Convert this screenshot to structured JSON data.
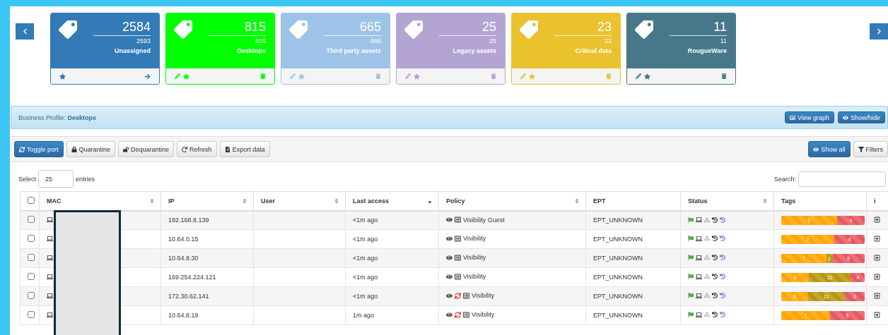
{
  "cards": [
    {
      "count": "2584",
      "total": "2593",
      "label": "Unassigned",
      "color": "#337ab7",
      "kind": "default"
    },
    {
      "count": "815",
      "total": "815",
      "label": "Desktops",
      "color": "#00ff00",
      "kind": "custom"
    },
    {
      "count": "665",
      "total": "666",
      "label": "Third party assets",
      "color": "#9dc3e8",
      "kind": "custom"
    },
    {
      "count": "25",
      "total": "25",
      "label": "Legacy assets",
      "color": "#b4a4d3",
      "kind": "custom"
    },
    {
      "count": "23",
      "total": "23",
      "label": "Critical data",
      "color": "#e9c22d",
      "kind": "custom"
    },
    {
      "count": "11",
      "total": "11",
      "label": "RougueWare",
      "color": "#46788a",
      "kind": "custom"
    }
  ],
  "profile": {
    "label": "Business Profile:",
    "value": "Desktops"
  },
  "panel_buttons": [
    {
      "label": "View graph"
    },
    {
      "label": "Show/hide"
    }
  ],
  "toolbar": {
    "left": [
      {
        "label": "Toggle port",
        "kind": "primary"
      },
      {
        "label": "Quarantine",
        "kind": "default"
      },
      {
        "label": "Dequarantine",
        "kind": "default"
      },
      {
        "label": "Refresh",
        "kind": "default"
      },
      {
        "label": "Export data",
        "kind": "default"
      }
    ],
    "right": [
      {
        "label": "Show all",
        "kind": "primary"
      },
      {
        "label": "Filters",
        "kind": "default"
      }
    ]
  },
  "length": {
    "before": "Select",
    "value": "25",
    "after": "entries"
  },
  "search": {
    "label": "Search:"
  },
  "table": {
    "select_all": {
      "checked": false
    },
    "columns": [
      {
        "label": "MAC",
        "sortable": true,
        "sorted": false
      },
      {
        "label": "IP",
        "sortable": true,
        "sorted": false
      },
      {
        "label": "User",
        "sortable": true,
        "sorted": false
      },
      {
        "label": "Last access",
        "sortable": true,
        "sorted": true
      },
      {
        "label": "Policy",
        "sortable": true,
        "sorted": false
      },
      {
        "label": "EPT",
        "sortable": false,
        "sorted": false
      },
      {
        "label": "Status",
        "sortable": true,
        "sorted": false
      },
      {
        "label": "Tags",
        "sortable": false,
        "sorted": false
      },
      {
        "label": "i",
        "sortable": false,
        "sorted": false
      }
    ],
    "rows": [
      {
        "checked": false,
        "ip": "192.168.8.139",
        "last_access": "<1m ago",
        "policy": {
          "syncing": false,
          "label": "Visibility Guest"
        },
        "ept": "EPT_UNKNOWN",
        "tags": [
          {
            "label": "8",
            "color": "#ffa500"
          },
          {
            "label": "4",
            "color": "#e8585f"
          }
        ]
      },
      {
        "checked": false,
        "ip": "10.64.0.15",
        "last_access": "<1m ago",
        "policy": {
          "syncing": false,
          "label": "Visibility"
        },
        "ept": "EPT_UNKNOWN",
        "tags": [
          {
            "label": "7",
            "color": "#ffa500"
          },
          {
            "label": "4",
            "color": "#e8585f"
          }
        ]
      },
      {
        "checked": false,
        "ip": "10.64.8.30",
        "last_access": "<1m ago",
        "policy": {
          "syncing": false,
          "label": "Visibility"
        },
        "ept": "EPT_UNKNOWN",
        "tags": [
          {
            "label": "7",
            "color": "#ffa500"
          },
          {
            "label": "1",
            "color": "#b8960c"
          },
          {
            "label": "5",
            "color": "#e8585f"
          }
        ]
      },
      {
        "checked": false,
        "ip": "169.254.224.121",
        "last_access": "<1m ago",
        "policy": {
          "syncing": false,
          "label": "Visibility"
        },
        "ept": "EPT_UNKNOWN",
        "tags": [
          {
            "label": "8",
            "color": "#ffa500"
          },
          {
            "label": "12",
            "color": "#b8960c"
          },
          {
            "label": "4",
            "color": "#e8585f"
          }
        ]
      },
      {
        "checked": false,
        "ip": "172.30.62.141",
        "last_access": "<1m ago",
        "policy": {
          "syncing": true,
          "label": "Visibility"
        },
        "ept": "EPT_UNKNOWN",
        "tags": [
          {
            "label": "8",
            "color": "#ffa500"
          },
          {
            "label": "11",
            "color": "#b8960c"
          },
          {
            "label": "6",
            "color": "#e8585f"
          }
        ]
      },
      {
        "checked": false,
        "ip": "10.64.8.19",
        "last_access": "1m ago",
        "policy": {
          "syncing": true,
          "label": "Visibility"
        },
        "ept": "EPT_UNKNOWN",
        "tags": [
          {
            "label": "7",
            "color": "#ffa500"
          },
          {
            "label": "5",
            "color": "#e8585f"
          }
        ]
      }
    ]
  }
}
